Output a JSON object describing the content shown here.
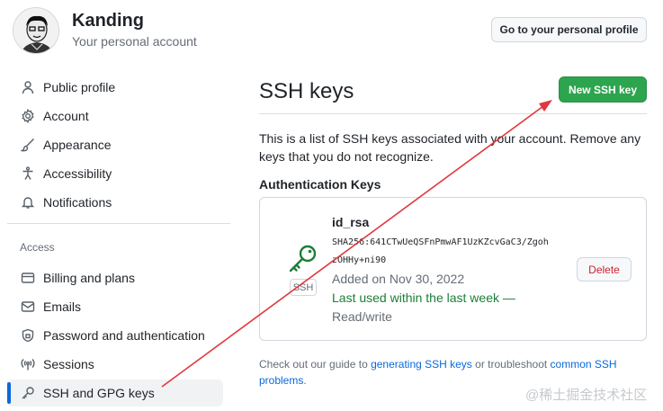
{
  "header": {
    "user_name": "Kanding",
    "user_subtitle": "Your personal account",
    "profile_button": "Go to your personal profile"
  },
  "sidebar": {
    "items": [
      {
        "label": "Public profile",
        "icon": "person-icon"
      },
      {
        "label": "Account",
        "icon": "gear-icon"
      },
      {
        "label": "Appearance",
        "icon": "paintbrush-icon"
      },
      {
        "label": "Accessibility",
        "icon": "accessibility-icon"
      },
      {
        "label": "Notifications",
        "icon": "bell-icon"
      }
    ],
    "section_label": "Access",
    "access_items": [
      {
        "label": "Billing and plans",
        "icon": "credit-card-icon"
      },
      {
        "label": "Emails",
        "icon": "mail-icon"
      },
      {
        "label": "Password and authentication",
        "icon": "shield-lock-icon"
      },
      {
        "label": "Sessions",
        "icon": "broadcast-icon"
      },
      {
        "label": "SSH and GPG keys",
        "icon": "key-icon",
        "active": true
      }
    ]
  },
  "main": {
    "title": "SSH keys",
    "new_key_button": "New SSH key",
    "intro_text": "This is a list of SSH keys associated with your account. Remove any keys that you do not recognize.",
    "section_title": "Authentication Keys",
    "key": {
      "name": "id_rsa",
      "fingerprint_line1": "SHA256:641CTwUeQSFnPmwAF1UzKZcvGaC3/Zgoh",
      "fingerprint_line2": "zOHHy+ni90",
      "type_tag": "SSH",
      "added": "Added on Nov 30, 2022",
      "last_used": "Last used within the last week —",
      "access": "Read/write",
      "delete_button": "Delete"
    },
    "guide": {
      "text_before": "Check out our guide to ",
      "link1": "generating SSH keys",
      "text_middle": " or troubleshoot ",
      "link2": "common SSH problems",
      "text_after": "."
    }
  },
  "watermark": "@稀土掘金技术社区",
  "colors": {
    "accent_green": "#2da44e",
    "link_blue": "#0969da",
    "danger_red": "#cf222e",
    "annotation_red": "#e0383e"
  }
}
